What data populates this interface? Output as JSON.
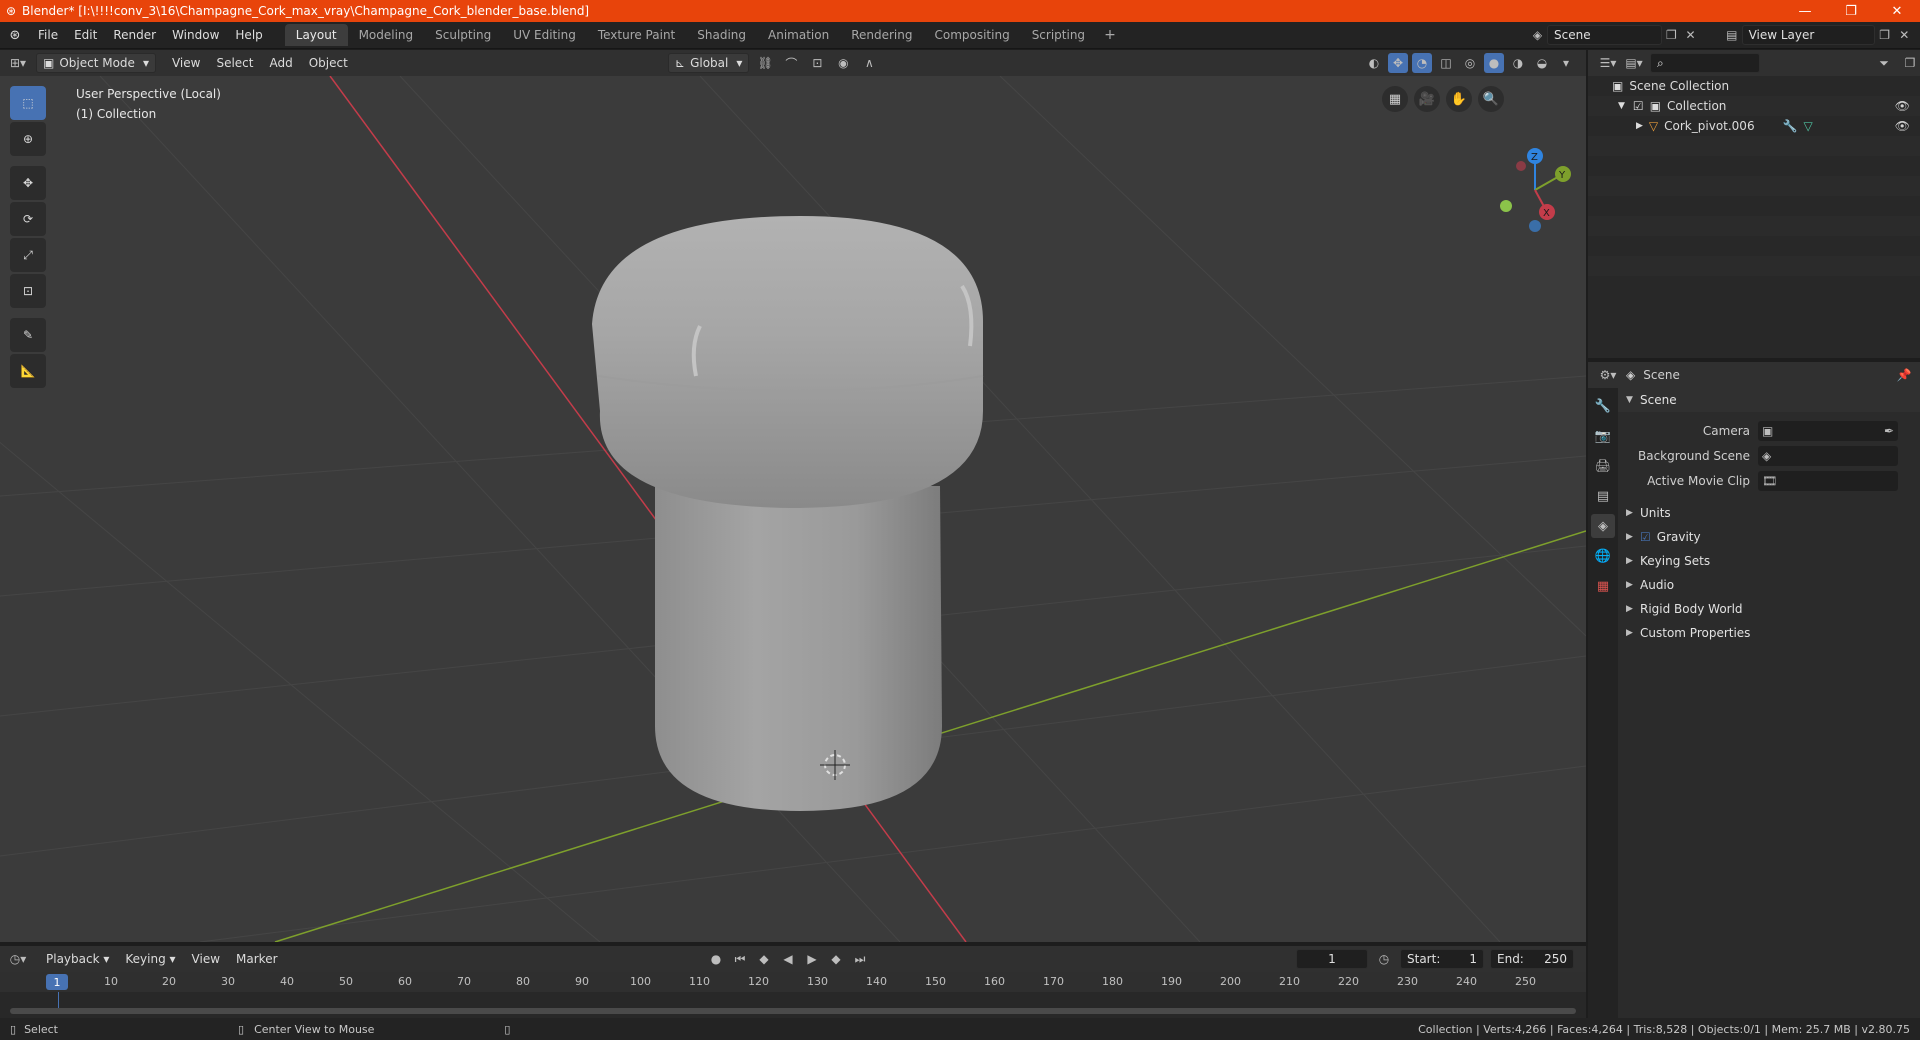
{
  "window": {
    "title": "Blender* [I:\\!!!!conv_3\\16\\Champagne_Cork_max_vray\\Champagne_Cork_blender_base.blend]",
    "minimize": "—",
    "restore": "❐",
    "close": "✕"
  },
  "menu": [
    "File",
    "Edit",
    "Render",
    "Window",
    "Help"
  ],
  "workspaces": [
    "Layout",
    "Modeling",
    "Sculpting",
    "UV Editing",
    "Texture Paint",
    "Shading",
    "Animation",
    "Rendering",
    "Compositing",
    "Scripting"
  ],
  "active_workspace": "Layout",
  "scene_name": "Scene",
  "view_layer": "View Layer",
  "viewport": {
    "mode": "Object Mode",
    "menus": [
      "View",
      "Select",
      "Add",
      "Object"
    ],
    "transform_orientation": "Global",
    "info_line1": "User Perspective (Local)",
    "info_line2": "(1) Collection",
    "axis_x": "X",
    "axis_y": "Y",
    "axis_z": "Z"
  },
  "outliner": {
    "scene_collection": "Scene Collection",
    "collection": "Collection",
    "object": "Cork_pivot.006"
  },
  "properties": {
    "header": "Scene",
    "panel": "Scene",
    "camera_label": "Camera",
    "background_scene_label": "Background Scene",
    "active_movie_clip_label": "Active Movie Clip",
    "subpanels": [
      "Units",
      "Gravity",
      "Keying Sets",
      "Audio",
      "Rigid Body World",
      "Custom Properties"
    ],
    "gravity_checked": true
  },
  "timeline": {
    "menus": [
      "Playback",
      "Keying",
      "View",
      "Marker"
    ],
    "current_frame": "1",
    "start_label": "Start:",
    "start": "1",
    "end_label": "End:",
    "end": "250",
    "ticks": [
      "1",
      "10",
      "20",
      "30",
      "40",
      "50",
      "60",
      "70",
      "80",
      "90",
      "100",
      "110",
      "120",
      "130",
      "140",
      "150",
      "160",
      "170",
      "180",
      "190",
      "200",
      "210",
      "220",
      "230",
      "240",
      "250"
    ]
  },
  "status": {
    "select": "Select",
    "center_view": "Center View to Mouse",
    "stats": "Collection | Verts:4,266 | Faces:4,264 | Tris:8,528 | Objects:0/1 | Mem: 25.7 MB | v2.80.75"
  },
  "colors": {
    "titlebar": "#e8440b",
    "active_tool": "#4772b3",
    "x_axis": "#c33c4a",
    "y_axis": "#7ea02c",
    "z_axis": "#2f84e0"
  }
}
